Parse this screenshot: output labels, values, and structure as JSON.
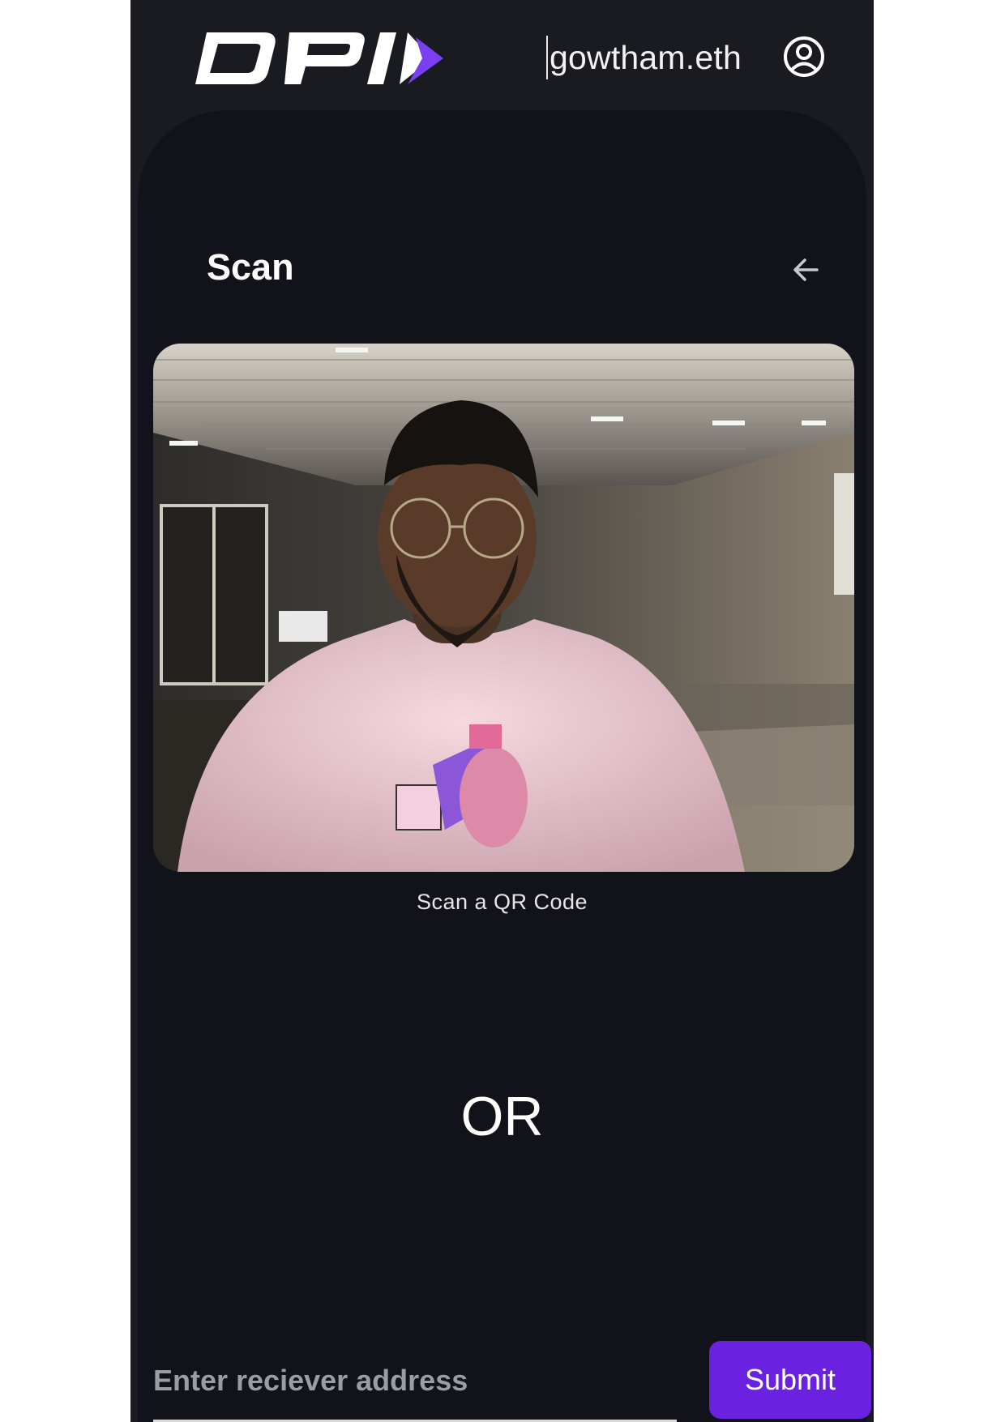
{
  "header": {
    "logo_text": "DPI",
    "username": "gowtham.eth",
    "profile_icon": "user-circle-icon"
  },
  "scan": {
    "title": "Scan",
    "back_icon": "arrow-left-icon",
    "camera_feed": "camera-preview",
    "caption": "Scan a QR Code"
  },
  "divider": {
    "or_label": "OR"
  },
  "address_form": {
    "placeholder": "Enter reciever address",
    "value": "",
    "submit_label": "Submit"
  },
  "colors": {
    "background": "#12131a",
    "header_bg": "#1a1b20",
    "accent": "#6a22e0",
    "logo_accent": "#7b3ff2"
  }
}
